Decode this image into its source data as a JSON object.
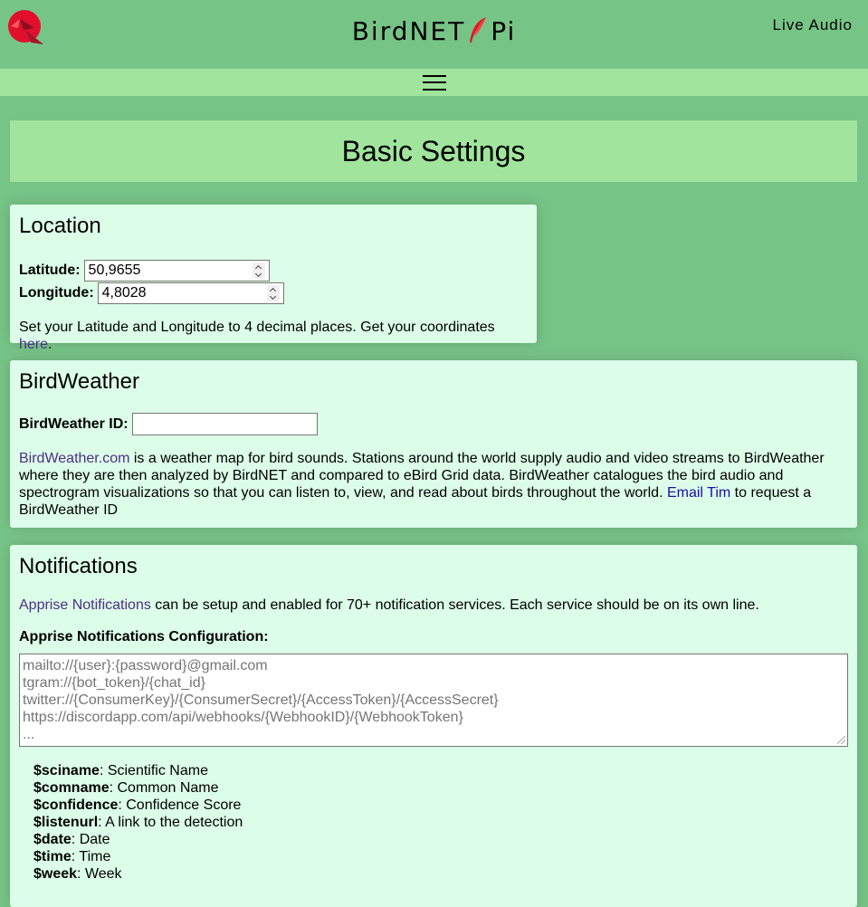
{
  "header": {
    "brand_left": "BirdNET",
    "brand_right": "Pi",
    "live_audio": "Live Audio"
  },
  "page_title": "Basic Settings",
  "location": {
    "heading": "Location",
    "latitude_label": "Latitude:",
    "latitude_value": "50,9655",
    "longitude_label": "Longitude:",
    "longitude_value": "4,8028",
    "help_text": "Set your Latitude and Longitude to 4 decimal places. Get your coordinates ",
    "help_link": "here",
    "help_end": "."
  },
  "birdweather": {
    "heading": "BirdWeather",
    "id_label": "BirdWeather ID:",
    "id_value": "",
    "link_text": "BirdWeather.com",
    "description": " is a weather map for bird sounds. Stations around the world supply audio and video streams to BirdWeather where they are then analyzed by BirdNET and compared to eBird Grid data. BirdWeather catalogues the bird audio and spectrogram visualizations so that you can listen to, view, and read about birds throughout the world. ",
    "email_link": "Email Tim",
    "description_end": " to request a BirdWeather ID"
  },
  "notifications": {
    "heading": "Notifications",
    "apprise_link": "Apprise Notifications",
    "intro": " can be setup and enabled for 70+ notification services. Each service should be on its own line.",
    "config_label": "Apprise Notifications Configuration:",
    "placeholder_lines": [
      "mailto://{user}:{password}@gmail.com",
      "tgram://{bot_token}/{chat_id}",
      "twitter://{ConsumerKey}/{ConsumerSecret}/{AccessToken}/{AccessSecret}",
      "https://discordapp.com/api/webhooks/{WebhookID}/{WebhookToken}",
      "..."
    ],
    "variables": [
      {
        "name": "$sciname",
        "desc": ": Scientific Name"
      },
      {
        "name": "$comname",
        "desc": ": Common Name"
      },
      {
        "name": "$confidence",
        "desc": ": Confidence Score"
      },
      {
        "name": "$listenurl",
        "desc": ": A link to the detection"
      },
      {
        "name": "$date",
        "desc": ": Date"
      },
      {
        "name": "$time",
        "desc": ": Time"
      },
      {
        "name": "$week",
        "desc": ": Week"
      }
    ]
  }
}
